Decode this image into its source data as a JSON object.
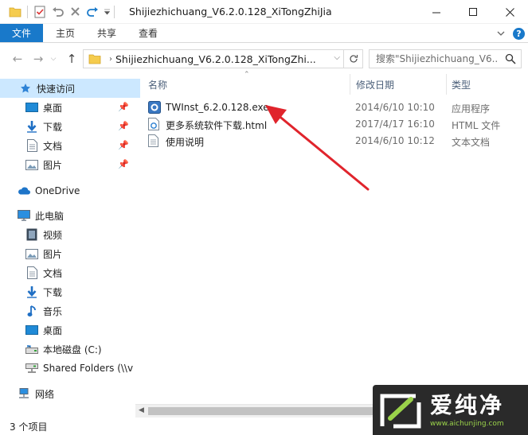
{
  "window": {
    "title": "Shijiezhichuang_V6.2.0.128_XiTongZhiJia"
  },
  "ribbon": {
    "tabs": [
      "文件",
      "主页",
      "共享",
      "查看"
    ]
  },
  "address": {
    "path": "Shijiezhichuang_V6.2.0.128_XiTongZhi...",
    "search_placeholder": "搜索\"Shijiezhichuang_V6...."
  },
  "nav": {
    "items": [
      {
        "label": "快速访问",
        "icon": "star-icon"
      },
      {
        "label": "桌面",
        "icon": "desktop-icon",
        "pinned": true
      },
      {
        "label": "下载",
        "icon": "download-icon",
        "pinned": true
      },
      {
        "label": "文档",
        "icon": "document-icon",
        "pinned": true
      },
      {
        "label": "图片",
        "icon": "pictures-icon",
        "pinned": true
      },
      {
        "label": "OneDrive",
        "icon": "cloud-icon"
      },
      {
        "label": "此电脑",
        "icon": "computer-icon"
      },
      {
        "label": "视频",
        "icon": "video-icon"
      },
      {
        "label": "图片",
        "icon": "pictures-icon"
      },
      {
        "label": "文档",
        "icon": "document-icon"
      },
      {
        "label": "下载",
        "icon": "download-icon"
      },
      {
        "label": "音乐",
        "icon": "music-icon"
      },
      {
        "label": "桌面",
        "icon": "desktop-icon"
      },
      {
        "label": "本地磁盘 (C:)",
        "icon": "drive-icon"
      },
      {
        "label": "Shared Folders (\\\\v",
        "icon": "network-drive-icon"
      },
      {
        "label": "网络",
        "icon": "network-icon"
      }
    ]
  },
  "columns": {
    "name": "名称",
    "date": "修改日期",
    "type": "类型"
  },
  "files": [
    {
      "name": "TWInst_6.2.0.128.exe",
      "date": "2014/6/10 10:10",
      "type": "应用程序",
      "icon": "exe-icon"
    },
    {
      "name": "更多系统软件下载.html",
      "date": "2017/4/17 16:10",
      "type": "HTML 文件",
      "icon": "html-file-icon"
    },
    {
      "name": "使用说明",
      "date": "2014/6/10 10:12",
      "type": "文本文档",
      "icon": "text-file-icon"
    }
  ],
  "status": {
    "count": "3 个项目"
  },
  "watermark": {
    "brand": "爱纯净",
    "url": "www.aichunjing.com"
  },
  "colors": {
    "accent": "#1979ca",
    "selection": "#cce8ff",
    "annotation_arrow": "#e0242c"
  }
}
